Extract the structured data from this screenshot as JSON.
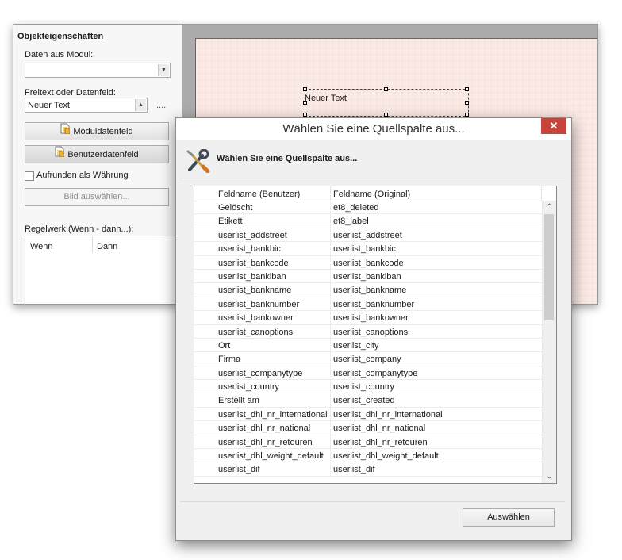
{
  "properties_panel": {
    "title": "Objekteigenschaften",
    "module_data_label": "Daten aus Modul:",
    "module_data_value": "",
    "freetext_label": "Freitext oder Datenfeld:",
    "freetext_value": "Neuer Text",
    "ellipsis": "....",
    "module_field_button": "Moduldatenfeld",
    "user_field_button": "Benutzerdatenfeld",
    "currency_checkbox_label": "Aufrunden als Währung",
    "currency_checked": false,
    "image_button": "Bild auswählen...",
    "rules_label": "Regelwerk (Wenn - dann...):",
    "rules_columns": [
      "Wenn",
      "Dann"
    ]
  },
  "canvas": {
    "textbox_value": "Neuer Text"
  },
  "dialog": {
    "title": "Wählen Sie eine Quellspalte aus...",
    "close_symbol": "✕",
    "header": "Wählen Sie eine Quellspalte aus...",
    "columns": [
      "Feldname (Benutzer)",
      "Feldname (Original)"
    ],
    "rows": [
      [
        "Gelöscht",
        "et8_deleted"
      ],
      [
        "Etikett",
        "et8_label"
      ],
      [
        "userlist_addstreet",
        "userlist_addstreet"
      ],
      [
        "userlist_bankbic",
        "userlist_bankbic"
      ],
      [
        "userlist_bankcode",
        "userlist_bankcode"
      ],
      [
        "userlist_bankiban",
        "userlist_bankiban"
      ],
      [
        "userlist_bankname",
        "userlist_bankname"
      ],
      [
        "userlist_banknumber",
        "userlist_banknumber"
      ],
      [
        "userlist_bankowner",
        "userlist_bankowner"
      ],
      [
        "userlist_canoptions",
        "userlist_canoptions"
      ],
      [
        "Ort",
        "userlist_city"
      ],
      [
        "Firma",
        "userlist_company"
      ],
      [
        "userlist_companytype",
        "userlist_companytype"
      ],
      [
        "userlist_country",
        "userlist_country"
      ],
      [
        "Erstellt am",
        "userlist_created"
      ],
      [
        "userlist_dhl_nr_international",
        "userlist_dhl_nr_international"
      ],
      [
        "userlist_dhl_nr_national",
        "userlist_dhl_nr_national"
      ],
      [
        "userlist_dhl_nr_retouren",
        "userlist_dhl_nr_retouren"
      ],
      [
        "userlist_dhl_weight_default",
        "userlist_dhl_weight_default"
      ],
      [
        "userlist_dif",
        "userlist_dif"
      ]
    ],
    "select_button": "Auswählen"
  },
  "icons": {
    "dropdown": "chevron-down-icon",
    "document": "document-icon",
    "tools": "tools-icon",
    "scroll_up": "chevron-up-icon",
    "scroll_down": "chevron-down-icon"
  },
  "colors": {
    "close_button": "#c7443a",
    "page_background": "#fbe9e4"
  }
}
